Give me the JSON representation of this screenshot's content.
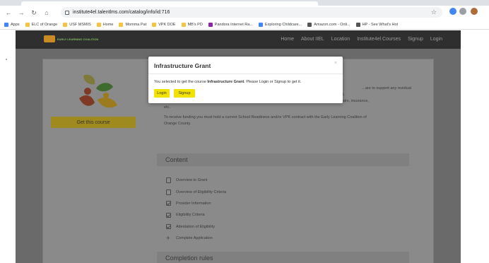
{
  "browser": {
    "url": "institute4el.talentlms.com/catalog/info/id:716",
    "bookmarks": [
      {
        "label": "Apps",
        "color": "#4285f4"
      },
      {
        "label": "ELC of Orange",
        "color": "#f4c542"
      },
      {
        "label": "USF MSMIS",
        "color": "#f4c542"
      },
      {
        "label": "Home",
        "color": "#f4c542"
      },
      {
        "label": "Momma Pat",
        "color": "#f4c542"
      },
      {
        "label": "VPK DOE",
        "color": "#f4c542"
      },
      {
        "label": "MB's PD",
        "color": "#f4c542"
      },
      {
        "label": "Pandora Internet Ra...",
        "color": "#8e24aa"
      },
      {
        "label": "Exploring Childcare...",
        "color": "#4285f4"
      },
      {
        "label": "Amazon.com - Onli...",
        "color": "#555555"
      },
      {
        "label": "HP - See What's Hot",
        "color": "#555555"
      }
    ]
  },
  "site": {
    "brand": "EARLY LEARNING COALITION",
    "nav": [
      "Home",
      "About IIEL",
      "Location",
      "Institute4el Courses",
      "Signup",
      "Login"
    ]
  },
  "course": {
    "get_course_label": "Get this course",
    "desc_line1": "...are to support any residual",
    "desc_line2": "impact ... due to your business's infrastructure. That includes costs associated with: a) cost of equipment,",
    "desc_line3": "supplies, staffing or b) costs to operate early learning/ child care centers such as rent, utilities, minor repairs, insurance,",
    "desc_line4": "etc.",
    "desc_para2_line1": "To receive funding you must hold a current School Readiness and/or VPK contract with the Early Learning Coalition of",
    "desc_para2_line2": "Orange County.",
    "content_heading": "Content",
    "content_items": [
      {
        "label": "Overview to Grant",
        "icon": "document-icon"
      },
      {
        "label": "Overview of Eligibility Criteria",
        "icon": "document-icon"
      },
      {
        "label": "Provider Information",
        "icon": "checkbox-icon"
      },
      {
        "label": "Eligibility Criteria",
        "icon": "checkbox-icon"
      },
      {
        "label": "Attestation of Eligibility",
        "icon": "checkbox-icon"
      },
      {
        "label": "Complete Application",
        "icon": "rocket-icon"
      }
    ],
    "completion_heading": "Completion rules"
  },
  "modal": {
    "title": "Infrastructure Grant",
    "body_prefix": "You selected to get the course ",
    "body_course": "Infrastructure Grant",
    "body_suffix": ". Please Login or Signup to get it.",
    "login_label": "Login",
    "signup_label": "Signup",
    "close_glyph": "×"
  },
  "colors": {
    "button_yellow": "#f2e200",
    "overlay_gray": "#6a6a6a"
  }
}
